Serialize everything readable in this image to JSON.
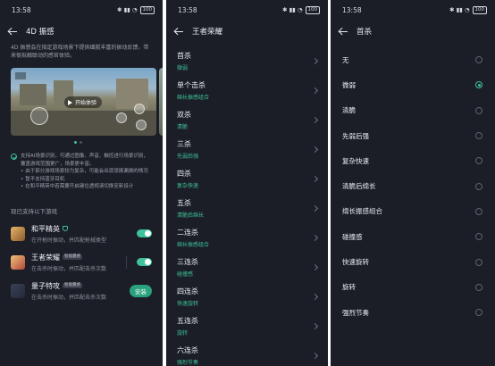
{
  "accent": "#3ec29a",
  "status": {
    "time": "13:58",
    "icons_text": "✱ ▮▮ ◔",
    "battery": "100"
  },
  "panel1": {
    "title": "4D 振感",
    "description": "4D 振感会在指定游戏场景下提供细腻丰富的振动反馈，带来很拟触联动的感官体验。",
    "play_label": "开始体验",
    "note_head": "支持AI场景识别，可通过图像、声音、触控进行场景识别，覆盖游戏范围更广，场景更丰富。",
    "note_items": [
      "由于部分游戏场景较为复杂，可能会出现误振漏振的情况",
      "暂不支持蓝牙耳机",
      "在和平精英中若需要开启键位透视请切换至新设计"
    ],
    "section_label": "现已支持以下游戏",
    "games": [
      {
        "name": "和平精英",
        "badge": "",
        "sub": "在开枪时振动，并匹配枪械类型",
        "action": "toggle"
      },
      {
        "name": "王者荣耀",
        "badge": "智能震感",
        "sub": "在击杀时振动，并匹配击杀次数",
        "action": "toggle"
      },
      {
        "name": "量子特攻",
        "badge": "智能震感",
        "sub": "在击杀时振动，并匹配击杀次数",
        "action": "安装"
      }
    ]
  },
  "panel2": {
    "title": "王者荣耀",
    "items": [
      {
        "label": "首杀",
        "sub": "微弱"
      },
      {
        "label": "单个击杀",
        "sub": "绵长振感组合"
      },
      {
        "label": "双杀",
        "sub": "清脆"
      },
      {
        "label": "三杀",
        "sub": "先弱后强"
      },
      {
        "label": "四杀",
        "sub": "复杂快速"
      },
      {
        "label": "五杀",
        "sub": "清脆后绵长"
      },
      {
        "label": "二连杀",
        "sub": "绵长振感组合"
      },
      {
        "label": "三连杀",
        "sub": "碰撞感"
      },
      {
        "label": "四连杀",
        "sub": "快速旋转"
      },
      {
        "label": "五连杀",
        "sub": "旋转"
      },
      {
        "label": "六连杀",
        "sub": "强烈节奏"
      }
    ]
  },
  "panel3": {
    "title": "首杀",
    "selected_index": 1,
    "options": [
      "无",
      "微弱",
      "清脆",
      "先弱后强",
      "复杂快速",
      "清脆后绵长",
      "绵长振感组合",
      "碰撞感",
      "快速旋转",
      "旋转",
      "强烈节奏"
    ]
  }
}
